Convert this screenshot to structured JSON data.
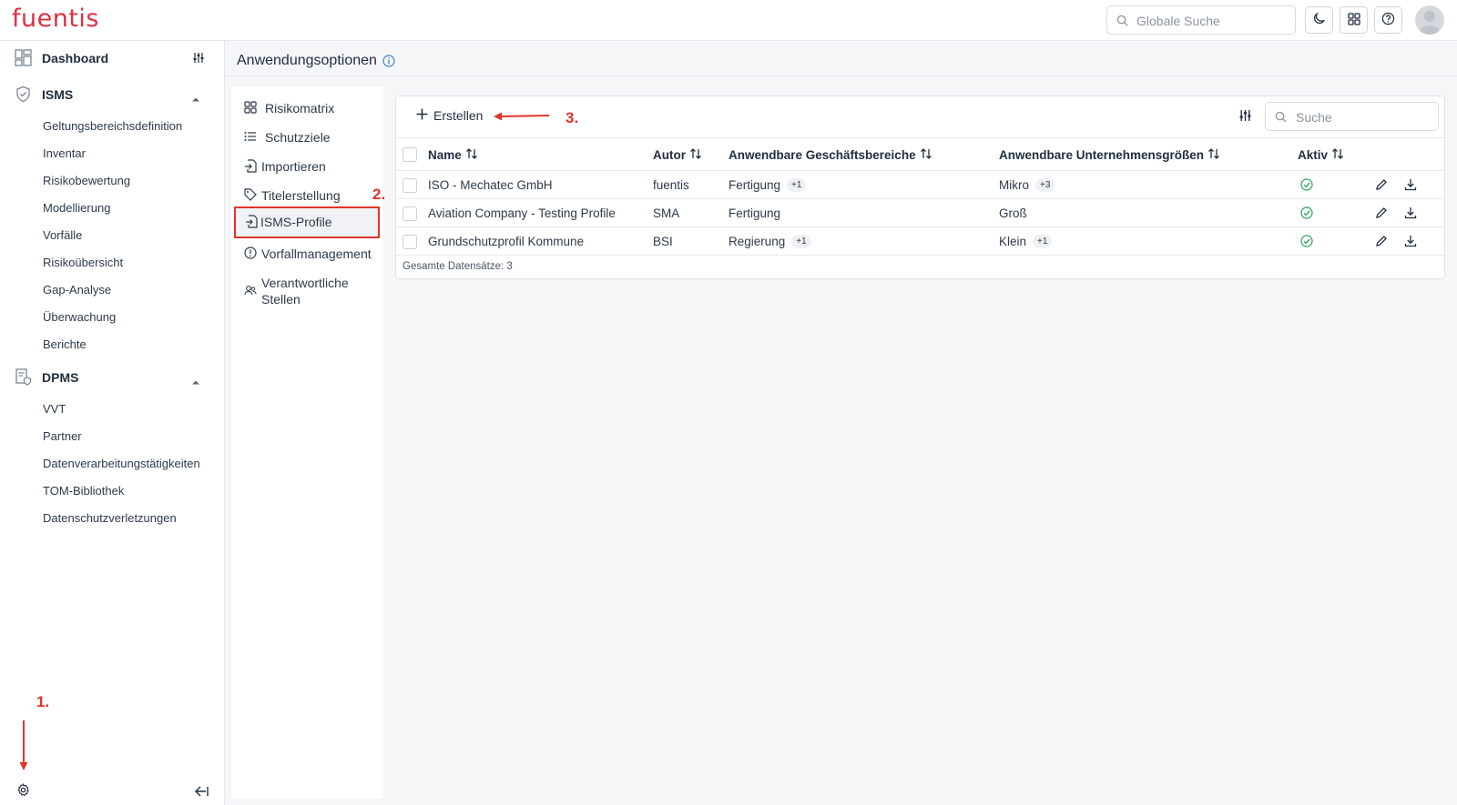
{
  "app": {
    "logo": "fuentis"
  },
  "topbar": {
    "search_placeholder": "Globale Suche",
    "buttons": [
      "moon-icon",
      "apps-grid-icon",
      "help-icon"
    ]
  },
  "sidebar": {
    "dashboard": {
      "label": "Dashboard"
    },
    "sections": [
      {
        "label": "ISMS",
        "items": [
          "Geltungsbereichsdefinition",
          "Inventar",
          "Risikobewertung",
          "Modellierung",
          "Vorfälle",
          "Risikoübersicht",
          "Gap-Analyse",
          "Überwachung",
          "Berichte"
        ]
      },
      {
        "label": "DPMS",
        "items": [
          "VVT",
          "Partner",
          "Datenverarbeitungstätigkeiten",
          "TOM-Bibliothek",
          "Datenschutzverletzungen"
        ]
      }
    ]
  },
  "page": {
    "title": "Anwendungsoptionen"
  },
  "subnav": {
    "items": [
      {
        "label": "Risikomatrix",
        "icon": "grid-icon"
      },
      {
        "label": "Schutzziele",
        "icon": "list-icon"
      },
      {
        "label": "Importieren",
        "icon": "import-icon"
      },
      {
        "label": "Titelerstellung",
        "icon": "tag-icon"
      },
      {
        "label": "ISMS-Profile",
        "icon": "profile-doc-icon",
        "active": true
      },
      {
        "label": "Vorfallmanagement",
        "icon": "alert-circle-icon"
      },
      {
        "label": "Verantwortliche Stellen",
        "icon": "users-icon"
      }
    ]
  },
  "table": {
    "create_label": "Erstellen",
    "search_placeholder": "Suche",
    "columns": [
      "Name",
      "Autor",
      "Anwendbare Geschäftsbereiche",
      "Anwendbare Unternehmensgrößen",
      "Aktiv"
    ],
    "rows": [
      {
        "name": "ISO - Mechatec GmbH",
        "author": "fuentis",
        "areas": "Fertigung",
        "areas_more": "+1",
        "sizes": "Mikro",
        "sizes_more": "+3",
        "active": true
      },
      {
        "name": "Aviation Company - Testing Profile",
        "author": "SMA",
        "areas": "Fertigung",
        "areas_more": "",
        "sizes": "Groß",
        "sizes_more": "",
        "active": true
      },
      {
        "name": "Grundschutzprofil Kommune",
        "author": "BSI",
        "areas": "Regierung",
        "areas_more": "+1",
        "sizes": "Klein",
        "sizes_more": "+1",
        "active": true
      }
    ],
    "footer": "Gesamte Datensätze: 3"
  },
  "annotations": {
    "step1": "1.",
    "step2": "2.",
    "step3": "3."
  },
  "colors": {
    "brand": "#e0303f",
    "annotation": "#e2342a",
    "active_check": "#27a35a"
  }
}
